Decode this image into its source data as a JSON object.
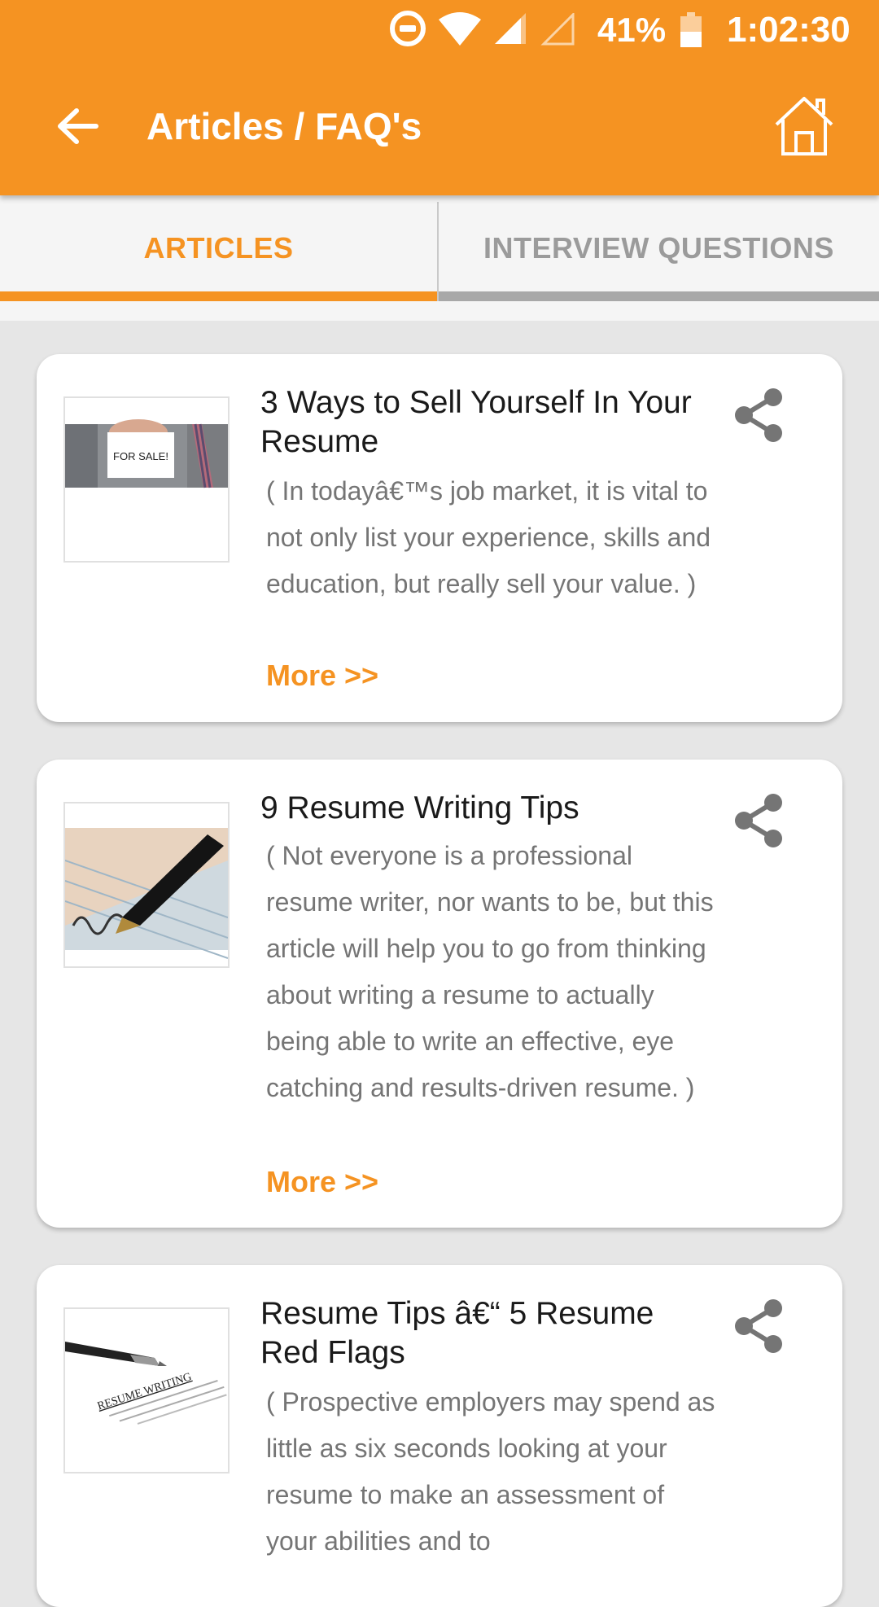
{
  "status_bar": {
    "battery_percent": "41%",
    "time": "1:02:30",
    "icons": [
      "do-not-disturb-icon",
      "wifi-icon",
      "cell-signal-icon",
      "cell-signal-empty-icon",
      "battery-icon"
    ]
  },
  "app_bar": {
    "title": "Articles / FAQ's",
    "back_icon": "arrow-left-icon",
    "home_icon": "home-icon"
  },
  "tabs": [
    {
      "label": "ARTICLES",
      "active": true
    },
    {
      "label": "INTERVIEW QUESTIONS",
      "active": false
    }
  ],
  "articles": [
    {
      "title": "3 Ways to Sell Yourself In Your Resume",
      "description": "( In todayâ€™s job market, it is vital to not only list your experience, skills and education, but really sell your value. )",
      "more_label": "More >>",
      "thumbnail_text": "FOR SALE!"
    },
    {
      "title": "9 Resume Writing Tips",
      "description": "( Not everyone is a professional resume writer, nor wants to be, but this article will help you to go from thinking about writing a resume to actually being able to write an effective, eye catching and results-driven resume. )",
      "more_label": "More >>"
    },
    {
      "title": "Resume Tips â€“ 5 Resume Red Flags",
      "description": "( Prospective employers may spend as little as six seconds looking at your resume to make an assessment of your abilities and to",
      "thumbnail_text": "RESUME WRITING"
    }
  ],
  "colors": {
    "accent": "#f59322",
    "background": "#e6e6e6",
    "card": "#ffffff",
    "inactive_tab": "#9b9b9b"
  }
}
